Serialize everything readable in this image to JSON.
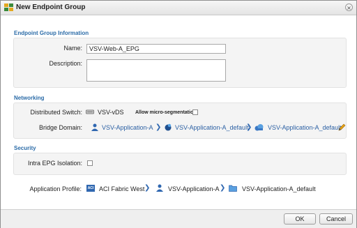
{
  "window": {
    "title": "New Endpoint Group",
    "close_glyph": "×"
  },
  "endpoint_group": {
    "section_title": "Endpoint Group Information",
    "name_label": "Name:",
    "name_value": "VSV-Web-A_EPG",
    "description_label": "Description:",
    "description_value": ""
  },
  "networking": {
    "section_title": "Networking",
    "switch_label": "Distributed Switch:",
    "switch_value": "VSV-vDS",
    "micro_seg_label": "Allow micro-segmentation:",
    "micro_seg_checked": false,
    "bridge_label": "Bridge Domain:",
    "bridge_path": [
      "VSV-Application-A",
      "VSV-Application-A_default",
      "VSV-Application-A_default"
    ]
  },
  "security": {
    "section_title": "Security",
    "isolation_label": "Intra EPG Isolation:",
    "isolation_checked": false
  },
  "app_profile": {
    "label": "Application Profile:",
    "fabric_badge": "ACI",
    "fabric": "ACI Fabric West",
    "tenant": "VSV-Application-A",
    "profile": "VSV-Application-A_default"
  },
  "footer": {
    "ok_label": "OK",
    "cancel_label": "Cancel"
  },
  "colors": {
    "accent": "#2c6ca8",
    "link": "#2a5fa3",
    "chevron": "#2f67b0"
  }
}
